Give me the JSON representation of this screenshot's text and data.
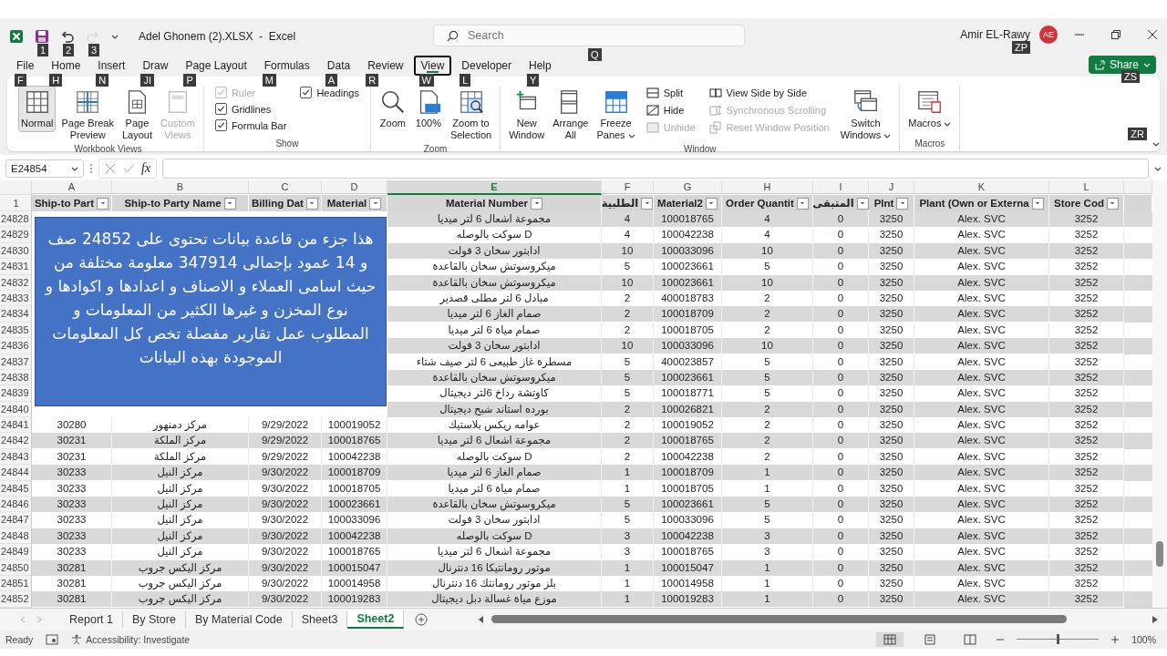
{
  "title_bar": {
    "quick_access": [
      {
        "kind": "save",
        "key_tip": "1",
        "disabled": false
      },
      {
        "kind": "undo",
        "key_tip": "2",
        "disabled": false
      },
      {
        "kind": "redo",
        "key_tip": "3",
        "disabled": true
      }
    ],
    "title": "Adel Ghonem (2).XLSX  -  Excel",
    "search": {
      "placeholder": "Search",
      "key_tip": "Q"
    },
    "user": {
      "name": "Amir EL-Rawy",
      "initials": "AE",
      "key_tip": "ZP"
    }
  },
  "menu_tabs": [
    {
      "label": "File",
      "key_tip": "F",
      "selected": false
    },
    {
      "label": "Home",
      "key_tip": "H",
      "selected": false
    },
    {
      "label": "Insert",
      "key_tip": "N",
      "selected": false
    },
    {
      "label": "Draw",
      "key_tip": "JI",
      "selected": false
    },
    {
      "label": "Page Layout",
      "key_tip": "P",
      "selected": false
    },
    {
      "label": "Formulas",
      "key_tip": "M",
      "selected": false
    },
    {
      "label": "Data",
      "key_tip": "A",
      "selected": false
    },
    {
      "label": "Review",
      "key_tip": "R",
      "selected": false
    },
    {
      "label": "View",
      "key_tip": "W",
      "selected": true
    },
    {
      "label": "Developer",
      "key_tip": "L",
      "selected": false
    },
    {
      "label": "Help",
      "key_tip": "Y",
      "selected": false
    }
  ],
  "share_button": {
    "label": "Share",
    "key_tip": "ZS"
  },
  "ribbon": {
    "collapse_key_tip": "ZR",
    "groups": [
      {
        "label": "Workbook Views",
        "items": [
          {
            "kind": "large",
            "label": "Normal",
            "selected": true,
            "disabled": false
          },
          {
            "kind": "large",
            "label": "Page Break\nPreview",
            "selected": false,
            "disabled": false
          },
          {
            "kind": "large",
            "label": "Page\nLayout",
            "selected": false,
            "disabled": false
          },
          {
            "kind": "large",
            "label": "Custom\nViews",
            "selected": false,
            "disabled": true
          }
        ]
      },
      {
        "label": "Show",
        "items": [
          {
            "kind": "check",
            "label": "Ruler",
            "checked": true,
            "disabled": true
          },
          {
            "kind": "check",
            "label": "Gridlines",
            "checked": true,
            "disabled": false
          },
          {
            "kind": "check",
            "label": "Formula Bar",
            "checked": true,
            "disabled": false
          },
          {
            "kind": "check",
            "label": "Headings",
            "checked": true,
            "disabled": false
          }
        ]
      },
      {
        "label": "Zoom",
        "items": [
          {
            "kind": "large",
            "label": "Zoom",
            "selected": false,
            "disabled": false
          },
          {
            "kind": "large",
            "label": "100%",
            "selected": false,
            "disabled": false
          },
          {
            "kind": "large",
            "label": "Zoom to\nSelection",
            "selected": false,
            "disabled": false
          }
        ]
      },
      {
        "label": "Window",
        "items": [
          {
            "kind": "large",
            "label": "New\nWindow",
            "selected": false,
            "disabled": false
          },
          {
            "kind": "large",
            "label": "Arrange\nAll",
            "selected": false,
            "disabled": false
          },
          {
            "kind": "large",
            "label": "Freeze\nPanes",
            "dropdown": true,
            "selected": false,
            "disabled": false
          },
          {
            "kind": "small",
            "label": "Split",
            "disabled": false
          },
          {
            "kind": "small",
            "label": "Hide",
            "disabled": false
          },
          {
            "kind": "small",
            "label": "Unhide",
            "disabled": true
          },
          {
            "kind": "small",
            "label": "View Side by Side",
            "disabled": false
          },
          {
            "kind": "small",
            "label": "Synchronous Scrolling",
            "disabled": true
          },
          {
            "kind": "small",
            "label": "Reset Window Position",
            "disabled": true
          },
          {
            "kind": "large",
            "label": "Switch\nWindows",
            "dropdown": true,
            "selected": false,
            "disabled": false
          }
        ]
      },
      {
        "label": "Macros",
        "items": [
          {
            "kind": "large",
            "label": "Macros",
            "dropdown": true,
            "selected": false,
            "disabled": false
          }
        ]
      }
    ]
  },
  "formula_bar": {
    "name_box": "E24854",
    "function_label": "fx"
  },
  "sheet": {
    "columns": [
      {
        "letter": "A",
        "header": "Ship-to Part",
        "selected": false
      },
      {
        "letter": "B",
        "header": "Ship-to Party Name",
        "selected": false
      },
      {
        "letter": "C",
        "header": "Billing Dat",
        "selected": false
      },
      {
        "letter": "D",
        "header": "Material",
        "selected": false
      },
      {
        "letter": "E",
        "header": "Material Number",
        "selected": true
      },
      {
        "letter": "F",
        "header": "الطلبية",
        "selected": false
      },
      {
        "letter": "G",
        "header": "Material2",
        "selected": false
      },
      {
        "letter": "H",
        "header": "Order Quantit",
        "selected": false
      },
      {
        "letter": "I",
        "header": "المتبقى",
        "selected": false
      },
      {
        "letter": "J",
        "header": "Plnt",
        "selected": false
      },
      {
        "letter": "K",
        "header": "Plant (Own or Externa",
        "selected": false
      },
      {
        "letter": "L",
        "header": "Store Cod",
        "selected": false
      }
    ],
    "header_row_number": "1",
    "rows": [
      {
        "number": "24828",
        "right_cells": [
          "مجموعة اشعال 6 لتر ميديا",
          "4",
          "100018765",
          "4",
          "0",
          "3250",
          "Alex. SVC",
          "3252"
        ]
      },
      {
        "number": "24829",
        "right_cells": [
          "سوكت بالوصله D",
          "4",
          "100042238",
          "4",
          "0",
          "3250",
          "Alex. SVC",
          "3252"
        ]
      },
      {
        "number": "24830",
        "right_cells": [
          "ادابتور سخان 3 فولت",
          "10",
          "100033096",
          "10",
          "0",
          "3250",
          "Alex. SVC",
          "3252"
        ]
      },
      {
        "number": "24831",
        "right_cells": [
          "ميكروسوتش سخان بالقاعدة",
          "5",
          "100023661",
          "5",
          "0",
          "3250",
          "Alex. SVC",
          "3252"
        ]
      },
      {
        "number": "24832",
        "right_cells": [
          "ميكروسوتش سخان بالقاعدة",
          "10",
          "100023661",
          "10",
          "0",
          "3250",
          "Alex. SVC",
          "3252"
        ]
      },
      {
        "number": "24833",
        "right_cells": [
          "مبادل 6 لتر مطلى قصدير",
          "2",
          "400018783",
          "2",
          "0",
          "3250",
          "Alex. SVC",
          "3252"
        ]
      },
      {
        "number": "24834",
        "right_cells": [
          "صمام الغاز 6 لتر ميديا",
          "2",
          "100018709",
          "2",
          "0",
          "3250",
          "Alex. SVC",
          "3252"
        ]
      },
      {
        "number": "24835",
        "right_cells": [
          "صمام مياة 6 لتر ميديا",
          "2",
          "100018705",
          "2",
          "0",
          "3250",
          "Alex. SVC",
          "3252"
        ]
      },
      {
        "number": "24836",
        "right_cells": [
          "ادابتور سخان 3 فولت",
          "10",
          "100033096",
          "10",
          "0",
          "3250",
          "Alex. SVC",
          "3252"
        ]
      },
      {
        "number": "24837",
        "right_cells": [
          "مسطرة غاز طبيعى 6 لتر صيف شتاء",
          "5",
          "400023857",
          "5",
          "0",
          "3250",
          "Alex. SVC",
          "3252"
        ]
      },
      {
        "number": "24838",
        "right_cells": [
          "ميكروسوتش سخان بالقاعدة",
          "5",
          "100023661",
          "5",
          "0",
          "3250",
          "Alex. SVC",
          "3252"
        ]
      },
      {
        "number": "24839",
        "right_cells": [
          "كاوتشة رداخ 6لتر ديجيتال",
          "5",
          "100018771",
          "5",
          "0",
          "3250",
          "Alex. SVC",
          "3252"
        ]
      },
      {
        "number": "24840",
        "right_cells": [
          "بورده استاند شبح ديجيتال",
          "2",
          "100026821",
          "2",
          "0",
          "3250",
          "Alex. SVC",
          "3252"
        ]
      },
      {
        "number": "24841",
        "left_cells": [
          "30280",
          "مركز دمنهور",
          "9/29/2022",
          "100019052"
        ],
        "right_cells": [
          "عوامه ريكس بلاستيك",
          "2",
          "100019052",
          "2",
          "0",
          "3250",
          "Alex. SVC",
          "3252"
        ]
      },
      {
        "number": "24842",
        "left_cells": [
          "30231",
          "مركز الملكة",
          "9/29/2022",
          "100018765"
        ],
        "right_cells": [
          "مجموعة اشعال 6 لتر ميديا",
          "2",
          "100018765",
          "2",
          "0",
          "3250",
          "Alex. SVC",
          "3252"
        ]
      },
      {
        "number": "24843",
        "left_cells": [
          "30231",
          "مركز الملكة",
          "9/29/2022",
          "100042238"
        ],
        "right_cells": [
          "سوكت بالوصله D",
          "2",
          "100042238",
          "2",
          "0",
          "3250",
          "Alex. SVC",
          "3252"
        ]
      },
      {
        "number": "24844",
        "left_cells": [
          "30233",
          "مركز النيل",
          "9/30/2022",
          "100018709"
        ],
        "right_cells": [
          "صمام الغاز 6 لتر ميديا",
          "1",
          "100018709",
          "1",
          "0",
          "3250",
          "Alex. SVC",
          "3252"
        ]
      },
      {
        "number": "24845",
        "left_cells": [
          "30233",
          "مركز النيل",
          "9/30/2022",
          "100018705"
        ],
        "right_cells": [
          "صمام مياة 6 لتر ميديا",
          "1",
          "100018705",
          "1",
          "0",
          "3250",
          "Alex. SVC",
          "3252"
        ]
      },
      {
        "number": "24846",
        "left_cells": [
          "30233",
          "مركز النيل",
          "9/30/2022",
          "100023661"
        ],
        "right_cells": [
          "ميكروسوتش سخان بالقاعدة",
          "5",
          "100023661",
          "5",
          "0",
          "3250",
          "Alex. SVC",
          "3252"
        ]
      },
      {
        "number": "24847",
        "left_cells": [
          "30233",
          "مركز النيل",
          "9/30/2022",
          "100033096"
        ],
        "right_cells": [
          "ادابتور سخان 3 فولت",
          "5",
          "100033096",
          "5",
          "0",
          "3250",
          "Alex. SVC",
          "3252"
        ]
      },
      {
        "number": "24848",
        "left_cells": [
          "30233",
          "مركز النيل",
          "9/30/2022",
          "100042238"
        ],
        "right_cells": [
          "سوكت بالوصله D",
          "3",
          "100042238",
          "3",
          "0",
          "3250",
          "Alex. SVC",
          "3252"
        ]
      },
      {
        "number": "24849",
        "left_cells": [
          "30233",
          "مركز النيل",
          "9/30/2022",
          "100018765"
        ],
        "right_cells": [
          "مجموعة اشعال 6 لتر ميديا",
          "3",
          "100018765",
          "3",
          "0",
          "3250",
          "Alex. SVC",
          "3252"
        ]
      },
      {
        "number": "24850",
        "left_cells": [
          "30281",
          "مركز اليكس جروب",
          "9/30/2022",
          "100015047"
        ],
        "right_cells": [
          "موتور رومانتيكا 16 دنترنال",
          "1",
          "100015047",
          "1",
          "0",
          "3250",
          "Alex. SVC",
          "3252"
        ]
      },
      {
        "number": "24851",
        "left_cells": [
          "30281",
          "مركز اليكس جروب",
          "9/30/2022",
          "100014958"
        ],
        "right_cells": [
          "بلز موتور رومانتك 16 دنترنال",
          "1",
          "100014958",
          "1",
          "0",
          "3250",
          "Alex. SVC",
          "3252"
        ]
      },
      {
        "number": "24852",
        "left_cells": [
          "30281",
          "مركز اليكس جروب",
          "9/30/2022",
          "100019283"
        ],
        "right_cells": [
          "موزع مياة غسالة دبل ديجيتال",
          "1",
          "100019283",
          "1",
          "0",
          "3250",
          "Alex. SVC",
          "3252"
        ]
      }
    ],
    "text_box": {
      "text": "هذا جزء من قاعدة بيانات تحتوى على 24852 صف و 14 عمود بإجمالى 347914 معلومة مختلفة من حيث اسامى العملاء و الاصناف و اعدادها و اكوادها و نوع المخزن و غيرها الكثير من المعلومات و المطلوب عمل تقارير مفصلة تخص كل المعلومات الموجودة بهذه البيانات"
    }
  },
  "sheet_tabs": [
    {
      "label": "Report 1",
      "selected": false
    },
    {
      "label": "By Store",
      "selected": false
    },
    {
      "label": "By Material Code",
      "selected": false
    },
    {
      "label": "Sheet3",
      "selected": false
    },
    {
      "label": "Sheet2",
      "selected": true
    }
  ],
  "status_bar": {
    "mode": "Ready",
    "accessibility": "Accessibility: Investigate",
    "views": [
      {
        "selected": true
      },
      {
        "selected": false
      },
      {
        "selected": false
      }
    ],
    "zoom": {
      "level": 0.5,
      "reading": "100%"
    }
  }
}
